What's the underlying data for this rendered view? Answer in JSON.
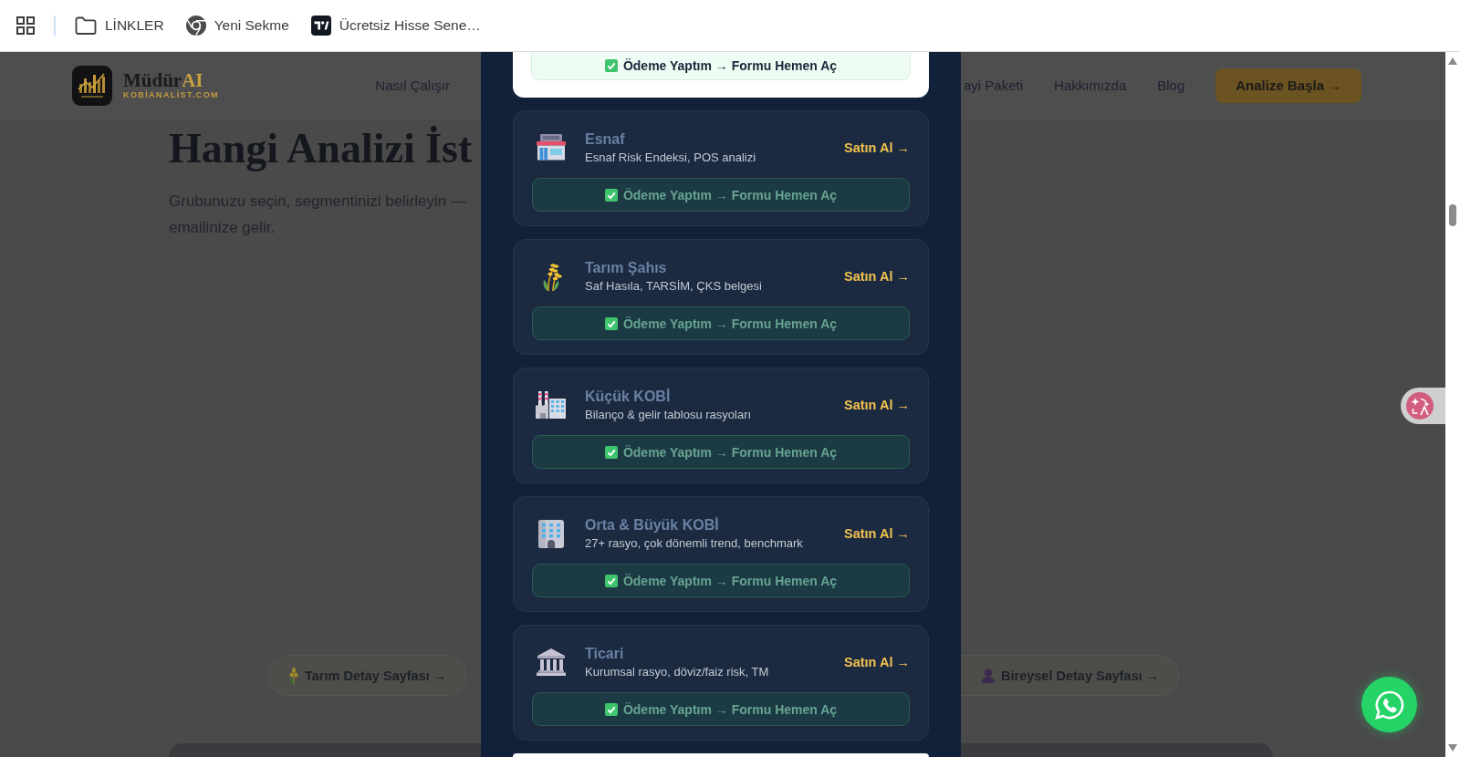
{
  "bookmarks": [
    {
      "kind": "folder",
      "label": "LİNKLER"
    },
    {
      "kind": "link",
      "label": "Yeni Sekme"
    },
    {
      "kind": "link",
      "label": "Ücretsiz Hisse Sene…"
    }
  ],
  "header": {
    "brand": {
      "name": "Müdür",
      "accent": "AI",
      "domain": "KOBİANALİST.COM"
    },
    "nav_left": [
      "Nasıl Çalışır"
    ],
    "nav_right": [
      "ayi Paketi",
      "Hakkımızda",
      "Blog"
    ],
    "cta": "Analize Başla →"
  },
  "hero": {
    "title": "Hangi Analizi İst",
    "description_lines": [
      "Grubunuzu seçin, segmentinizi belirleyin —",
      "emailinize gelir."
    ]
  },
  "detail_links": [
    {
      "label": "Tarım Detay Sayfası →"
    },
    {
      "label": "Bireysel Detay Sayfası →"
    }
  ],
  "modal": {
    "top_package": {
      "confirm_button": "Ödeme Yaptım → Formu Hemen Aç"
    },
    "packages": [
      {
        "title": "Esnaf",
        "description": "Esnaf Risk Endeksi, POS analizi",
        "buy": "Satın Al →",
        "confirm_button": "Ödeme Yaptım → Formu Hemen Aç"
      },
      {
        "title": "Tarım Şahıs",
        "description": "Saf Hasıla, TARSİM, ÇKS belgesi",
        "buy": "Satın Al →",
        "confirm_button": "Ödeme Yaptım → Formu Hemen Aç"
      },
      {
        "title": "Küçük KOBİ",
        "description": "Bilanço & gelir tablosu rasyoları",
        "buy": "Satın Al →",
        "confirm_button": "Ödeme Yaptım → Formu Hemen Aç"
      },
      {
        "title": "Orta & Büyük KOBİ",
        "description": "27+ rasyo, çok dönemli trend, benchmark",
        "buy": "Satın Al →",
        "confirm_button": "Ödeme Yaptım → Formu Hemen Aç"
      },
      {
        "title": "Ticari",
        "description": "Kurumsal rasyo, döviz/faiz risk, TM",
        "buy": "Satın Al →",
        "confirm_button": "Ödeme Yaptım → Formu Hemen Aç"
      }
    ]
  }
}
